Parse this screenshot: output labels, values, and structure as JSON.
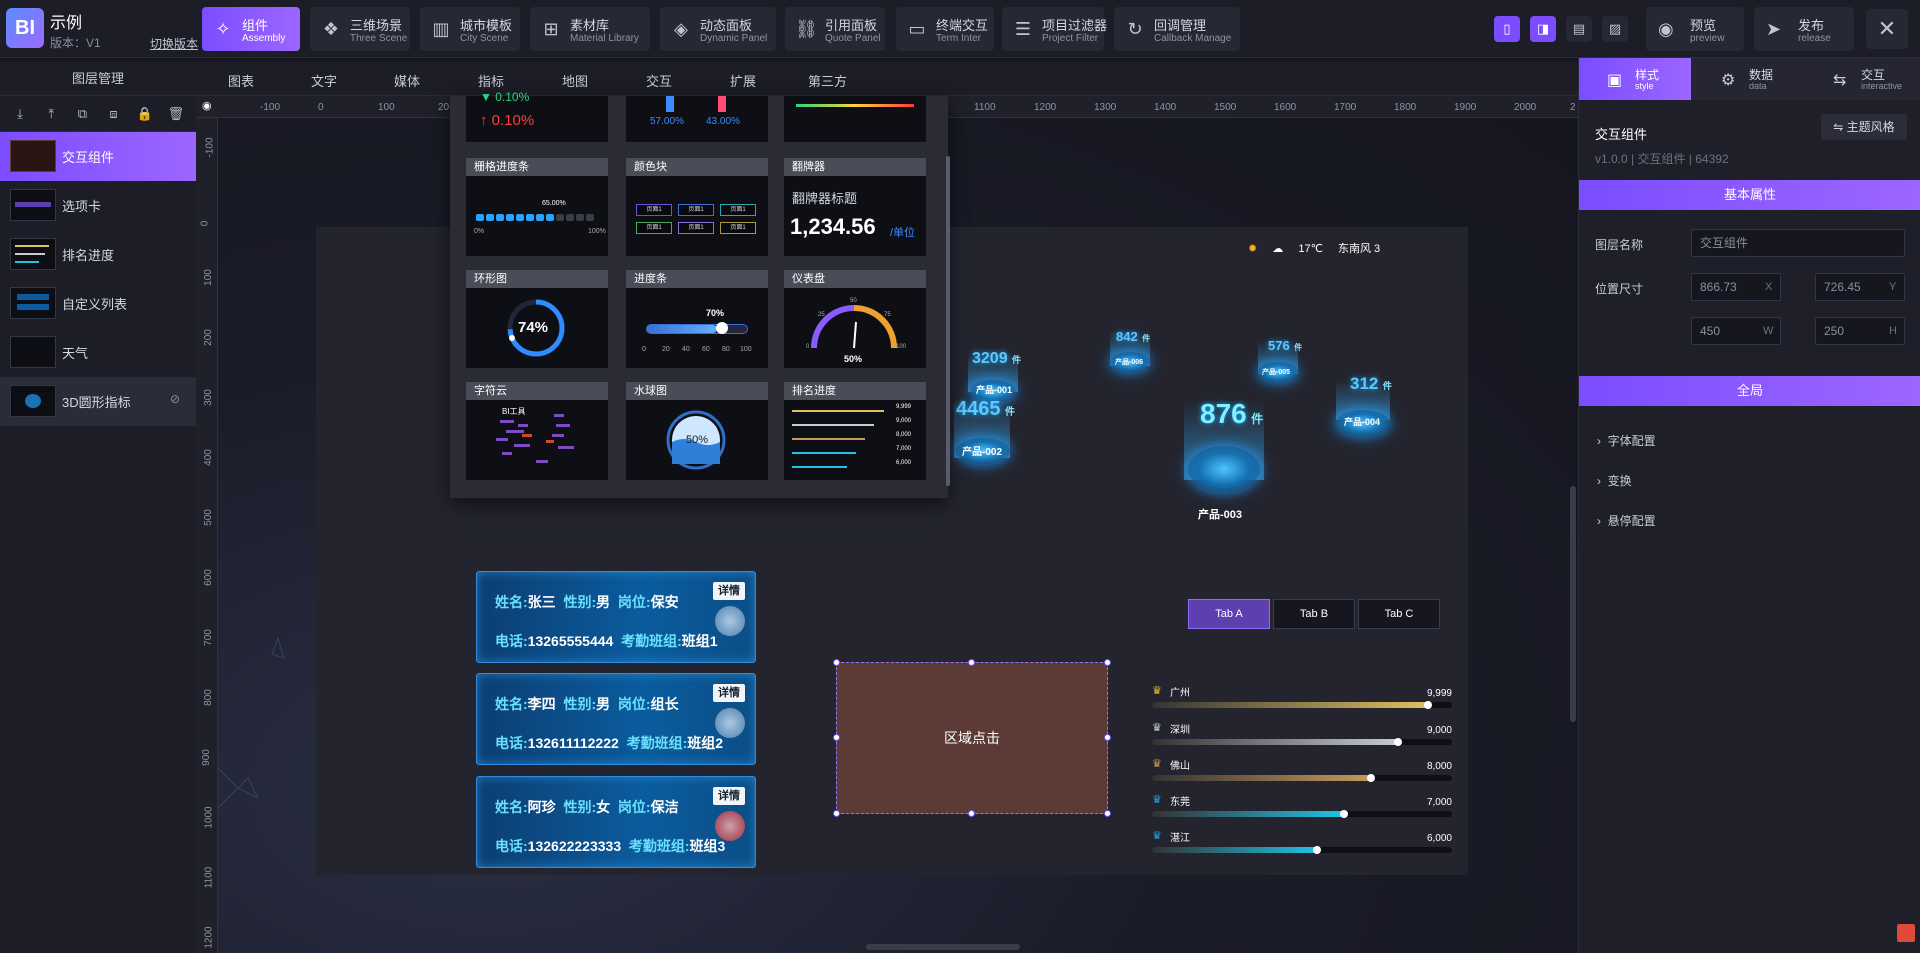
{
  "app": {
    "logo": "BI",
    "title": "示例",
    "version": "版本：V1",
    "switch_version": "切换版本"
  },
  "toolbar": [
    {
      "zh": "组件",
      "en": "Assembly",
      "icon": "puzzle-icon",
      "glyph": "✧"
    },
    {
      "zh": "三维场景",
      "en": "Three Scene",
      "icon": "cubes-icon",
      "glyph": "❖"
    },
    {
      "zh": "城市模板",
      "en": "City Scene",
      "icon": "building-icon",
      "glyph": "▥"
    },
    {
      "zh": "素材库",
      "en": "Material Library",
      "icon": "grid-icon",
      "glyph": "⊞"
    },
    {
      "zh": "动态面板",
      "en": "Dynamic Panel",
      "icon": "layers-icon",
      "glyph": "◈"
    },
    {
      "zh": "引用面板",
      "en": "Quote Panel",
      "icon": "link-icon",
      "glyph": "⛓"
    },
    {
      "zh": "终端交互",
      "en": "Term Inter",
      "icon": "monitor-icon",
      "glyph": "▭"
    },
    {
      "zh": "项目过滤器",
      "en": "Project Filter",
      "icon": "filter-icon",
      "glyph": "☰"
    },
    {
      "zh": "回调管理",
      "en": "Callback Manage",
      "icon": "callback-icon",
      "glyph": "↻"
    }
  ],
  "view_buttons": [
    "▯",
    "◨",
    "▤",
    "▨"
  ],
  "preview": {
    "zh": "预览",
    "en": "preview"
  },
  "release": {
    "zh": "发布",
    "en": "release"
  },
  "close": "✕",
  "left_panel": {
    "title": "图层管理",
    "tools": [
      "⤓",
      "⤒",
      "⧉",
      "⧈",
      "🔒",
      "🗑"
    ],
    "layers": [
      {
        "name": "交互组件"
      },
      {
        "name": "选项卡"
      },
      {
        "name": "排名进度"
      },
      {
        "name": "自定义列表"
      },
      {
        "name": "天气"
      },
      {
        "name": "3D圆形指标"
      }
    ]
  },
  "categories": [
    "图表",
    "文字",
    "媒体",
    "指标",
    "地图",
    "交互",
    "扩展",
    "第三方"
  ],
  "hruler": [
    "-100",
    "0",
    "100",
    "20",
    "1100",
    "1200",
    "1300",
    "1400",
    "1500",
    "1600",
    "1700",
    "1800",
    "1900",
    "2000",
    "2"
  ],
  "vruler": [
    "-100",
    "0",
    "100",
    "200",
    "300",
    "400",
    "500",
    "600",
    "700",
    "800",
    "900",
    "1000",
    "1100",
    "1200"
  ],
  "popup": {
    "top_row": {
      "pct1": "0.10%",
      "pct2": "0.10%",
      "male": "57.00%",
      "female": "43.00%"
    },
    "cards": [
      {
        "title": "栅格进度条",
        "sub": "65.00%",
        "min": "0%",
        "max": "100%"
      },
      {
        "title": "颜色块",
        "chips": [
          "页面1",
          "页面1",
          "页面1",
          "页面1",
          "页面1",
          "页面1"
        ]
      },
      {
        "title": "翻牌器",
        "heading": "翻牌器标题",
        "number": "1,234.56",
        "unit": "/单位"
      },
      {
        "title": "环形图",
        "value": "74%"
      },
      {
        "title": "进度条",
        "value": "70%",
        "ticks": [
          "0",
          "20",
          "40",
          "60",
          "80",
          "100"
        ]
      },
      {
        "title": "仪表盘",
        "value": "50%",
        "marks": [
          "0",
          "25",
          "50",
          "75",
          "100"
        ]
      },
      {
        "title": "字符云",
        "text": "BI工具"
      },
      {
        "title": "水球图",
        "value": "50%"
      },
      {
        "title": "排名进度",
        "values": [
          "9,999",
          "9,000",
          "8,000",
          "7,000",
          "6,000"
        ]
      }
    ]
  },
  "weather": {
    "temp": "17℃",
    "wind": "东南风 3"
  },
  "indicators": [
    {
      "value": "3209",
      "unit": "件",
      "label": "产品-001"
    },
    {
      "value": "4465",
      "unit": "件",
      "label": "产品-002"
    },
    {
      "value": "842",
      "unit": "件",
      "label": "产品-006"
    },
    {
      "value": "876",
      "unit": "件",
      "label": "产品-003"
    },
    {
      "value": "576",
      "unit": "件",
      "label": "产品-005"
    },
    {
      "value": "312",
      "unit": "件",
      "label": "产品-004"
    }
  ],
  "people": [
    {
      "name_k": "姓名:",
      "name": "张三",
      "sex_k": "性别:",
      "sex": "男",
      "pos_k": "岗位:",
      "pos": "保安",
      "tel_k": "电话:",
      "tel": "13265555444",
      "shift_k": "考勤班组:",
      "shift": "班组1",
      "badge": "详情"
    },
    {
      "name_k": "姓名:",
      "name": "李四",
      "sex_k": "性别:",
      "sex": "男",
      "pos_k": "岗位:",
      "pos": "组长",
      "tel_k": "电话:",
      "tel": "132611112222",
      "shift_k": "考勤班组:",
      "shift": "班组2",
      "badge": "详情"
    },
    {
      "name_k": "姓名:",
      "name": "阿珍",
      "sex_k": "性别:",
      "sex": "女",
      "pos_k": "岗位:",
      "pos": "保洁",
      "tel_k": "电话:",
      "tel": "132622223333",
      "shift_k": "考勤班组:",
      "shift": "班组3",
      "badge": "详情"
    }
  ],
  "area_text": "区域点击",
  "tabs": [
    "Tab A",
    "Tab B",
    "Tab C"
  ],
  "ranking": [
    {
      "city": "广州",
      "value": "9,999",
      "pct": 0.92,
      "color": "#e0c060"
    },
    {
      "city": "深圳",
      "value": "9,000",
      "pct": 0.82,
      "color": "#c8cbd4"
    },
    {
      "city": "佛山",
      "value": "8,000",
      "pct": 0.73,
      "color": "#c89a5a"
    },
    {
      "city": "东莞",
      "value": "7,000",
      "pct": 0.64,
      "color": "#21c3e6"
    },
    {
      "city": "湛江",
      "value": "6,000",
      "pct": 0.55,
      "color": "#21c3e6"
    }
  ],
  "right_panel": {
    "tabs": [
      {
        "zh": "样式",
        "en": "style",
        "glyph": "▣"
      },
      {
        "zh": "数据",
        "en": "data",
        "glyph": "⚙"
      },
      {
        "zh": "交互",
        "en": "interactive",
        "glyph": "⇆"
      }
    ],
    "component": "交互组件",
    "version": "v1.0.0 | 交互组件 | 64392",
    "theme": "⇋ 主题风格",
    "basic": "基本属性",
    "layer_name_label": "图层名称",
    "layer_name": "交互组件",
    "pos_size_label": "位置尺寸",
    "x": "866.73",
    "x_s": "X",
    "y": "726.45",
    "y_s": "Y",
    "w": "450",
    "w_s": "W",
    "h": "250",
    "h_s": "H",
    "global": "全局",
    "folds": [
      "字体配置",
      "变换",
      "悬停配置"
    ]
  }
}
